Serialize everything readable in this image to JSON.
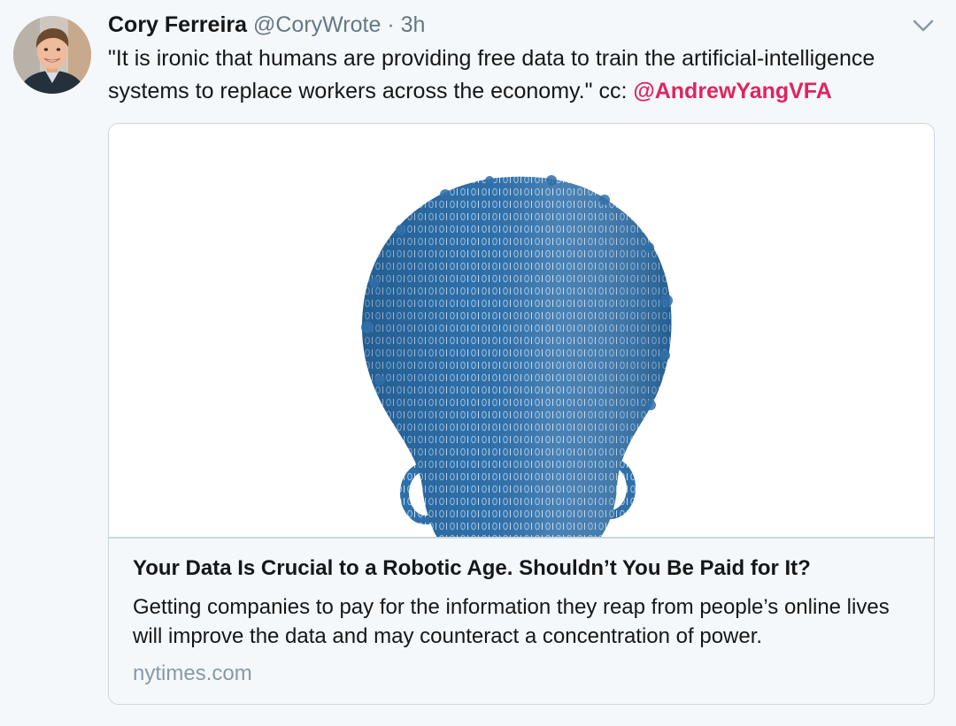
{
  "tweet": {
    "display_name": "Cory Ferreira",
    "handle": "@CoryWrote",
    "separator": "·",
    "timestamp": "3h",
    "text_main": "\"It is ironic that humans are providing free data to train the artificial-intelligence systems to replace workers across the economy.\"  cc: ",
    "mention": "@AndrewYangVFA",
    "avatar_icon": "person-photo",
    "menu_icon": "chevron-down-icon"
  },
  "card": {
    "image_icon": "binary-code-head-silhouette",
    "title": "Your Data Is Crucial to a Robotic Age. Shouldn’t You Be Paid for It?",
    "description": "Getting companies to pay for the information they reap from people’s online lives will improve the data and may counteract a concentration of power.",
    "domain": "nytimes.com"
  },
  "colors": {
    "background": "#f5f8fa",
    "mention": "#e0245e",
    "muted": "#657786",
    "border": "#ccd6dd",
    "silhouette": "#2f6fa8"
  }
}
